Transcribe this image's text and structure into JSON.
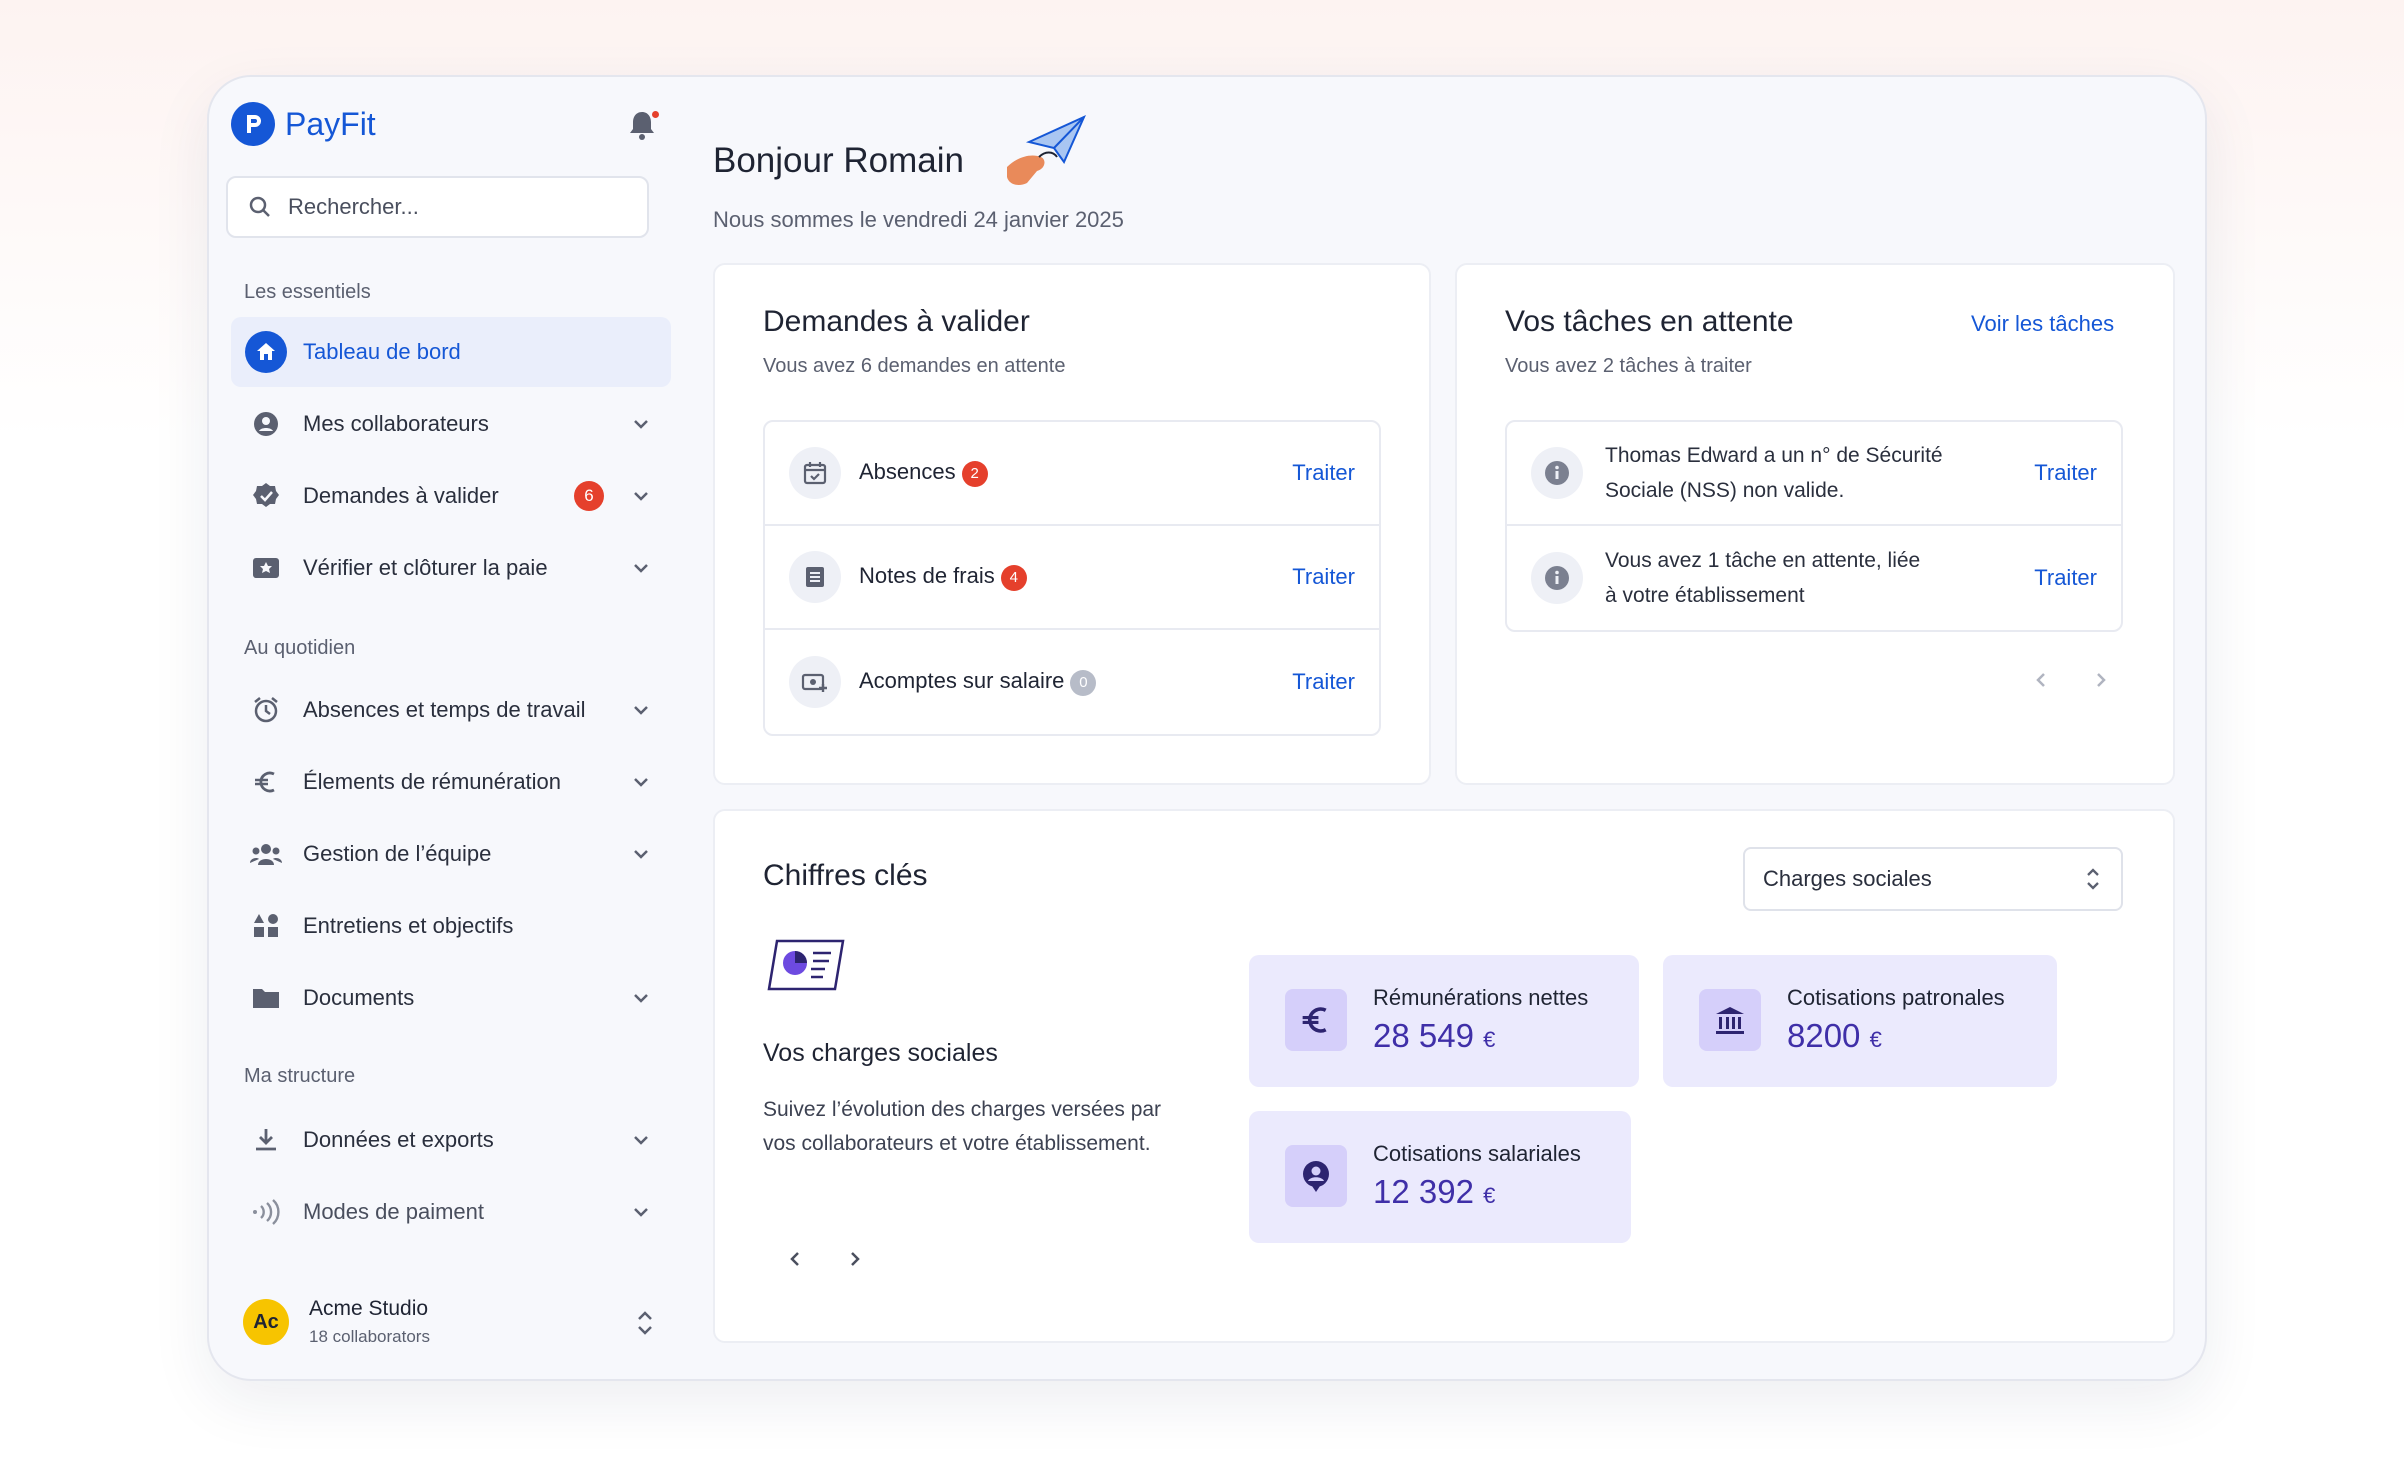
{
  "app": {
    "name": "PayFit"
  },
  "search": {
    "placeholder": "Rechercher..."
  },
  "sidebar": {
    "sections": [
      "Les essentiels",
      "Au quotidien",
      "Ma structure"
    ],
    "items": [
      {
        "label": "Tableau de bord",
        "icon": "home-icon",
        "active": true
      },
      {
        "label": "Mes collaborateurs",
        "icon": "user-circle-icon"
      },
      {
        "label": "Demandes à valider",
        "icon": "check-badge-icon",
        "badge": "6"
      },
      {
        "label": "Vérifier et clôturer la paie",
        "icon": "star-ticket-icon"
      },
      {
        "label": "Absences et temps de travail",
        "icon": "alarm-clock-icon"
      },
      {
        "label": "Élements de rémunération",
        "icon": "euro-icon"
      },
      {
        "label": "Gestion de l’équipe",
        "icon": "team-icon"
      },
      {
        "label": "Entretiens et objectifs",
        "icon": "shapes-icon"
      },
      {
        "label": "Documents",
        "icon": "folder-icon"
      },
      {
        "label": "Données et exports",
        "icon": "download-icon"
      },
      {
        "label": "Modes de paiment",
        "icon": "contactless-icon"
      }
    ],
    "org": {
      "initials": "Ac",
      "name": "Acme Studio",
      "sub": "18 collaborators"
    }
  },
  "header": {
    "greeting": "Bonjour Romain",
    "date": "Nous sommes le vendredi 24 janvier 2025"
  },
  "requests": {
    "title": "Demandes à valider",
    "subtitle": "Vous avez 6 demandes en attente",
    "action": "Traiter",
    "rows": [
      {
        "label": "Absences",
        "count": "2",
        "icon": "calendar-check-icon"
      },
      {
        "label": "Notes de frais",
        "count": "4",
        "icon": "receipt-icon"
      },
      {
        "label": "Acomptes sur salaire",
        "count": "0",
        "icon": "money-plus-icon"
      }
    ]
  },
  "tasks": {
    "title": "Vos tâches en attente",
    "link": "Voir les tâches",
    "subtitle": "Vous avez 2 tâches à traiter",
    "action": "Traiter",
    "rows": [
      {
        "text": "Thomas Edward a un n° de Sécurité Sociale (NSS) non valide."
      },
      {
        "text": "Vous avez 1 tâche en attente, liée à votre établissement"
      }
    ]
  },
  "keyfigures": {
    "title": "Chiffres clés",
    "select": "Charges sociales",
    "heading": "Vos charges sociales",
    "description": "Suivez l’évolution des charges versées par vos collaborateurs et votre établissement.",
    "cards": [
      {
        "label": "Rémunérations nettes",
        "value": "28 549",
        "unit": "€",
        "icon": "euro-icon"
      },
      {
        "label": "Cotisations patronales",
        "value": "8200",
        "unit": "€",
        "icon": "bank-icon"
      },
      {
        "label": "Cotisations salariales",
        "value": "12 392",
        "unit": "€",
        "icon": "user-badge-icon"
      }
    ]
  },
  "colors": {
    "accent": "#1557d6",
    "badge": "#e5402c",
    "kpi_bg": "#ebeafd",
    "kpi_value": "#3f2fa8"
  }
}
